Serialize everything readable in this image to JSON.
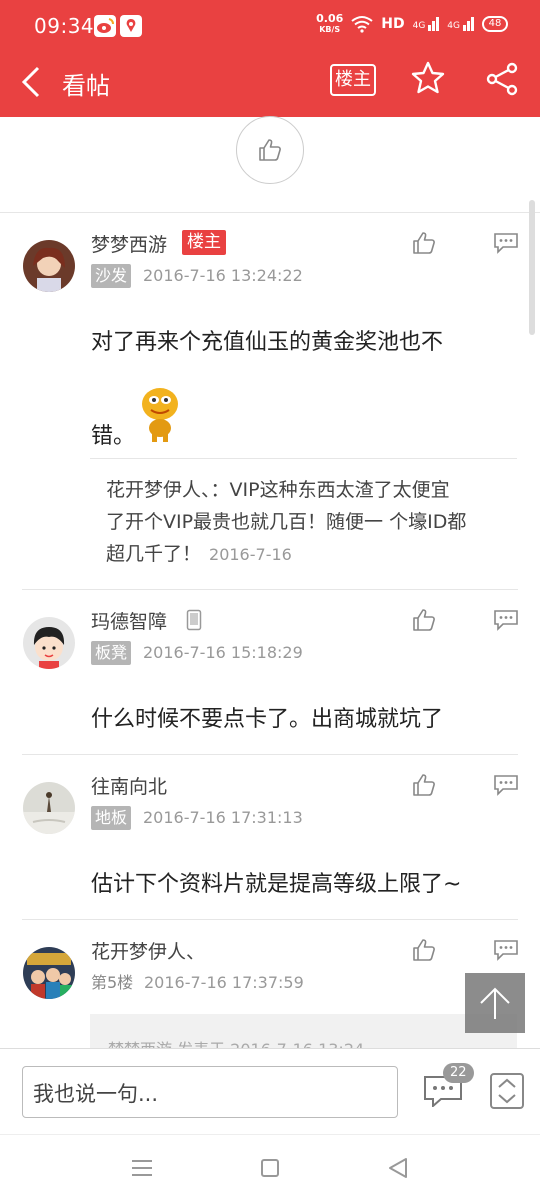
{
  "status_bar": {
    "time": "09:34",
    "net_speed_value": "0.06",
    "net_speed_unit": "KB/S",
    "hd_label": "HD",
    "signal_1": "4G",
    "signal_2": "4G",
    "battery": "48"
  },
  "header": {
    "title": "看帖",
    "louzhu_button": "楼主",
    "icons": [
      "back-icon",
      "star-icon",
      "share-icon"
    ]
  },
  "posts": [
    {
      "name": "梦梦西游",
      "tag": "楼主",
      "floor": "沙发",
      "time": "2016-7-16 13:24:22",
      "content_line1": "对了再来个充值仙玉的黄金奖池也不",
      "content_line2": "错。",
      "quote_author": "花开梦伊人、",
      "quote_text_l1": "：VIP这种东西太渣了太便宜",
      "quote_text_l2": "了开个VIP最贵也就几百！随便一 个壕ID都",
      "quote_text_l3": "超几千了！",
      "quote_time": "2016-7-16"
    },
    {
      "name": "玛德智障",
      "floor": "板凳",
      "time": "2016-7-16 15:18:29",
      "content": "什么时候不要点卡了。出商城就坑了"
    },
    {
      "name": "往南向北",
      "floor": "地板",
      "time": "2016-7-16 17:31:13",
      "content": "估计下个资料片就是提高等级上限了~"
    },
    {
      "name": "花开梦伊人、",
      "floor": "第5楼",
      "time": "2016-7-16 17:37:59",
      "quote_preview": "梦梦西游 发表于 2016-7-16 13:24"
    }
  ],
  "bottom_bar": {
    "input_placeholder": "我也说一句...",
    "comment_count": "22"
  },
  "colors": {
    "brand_red": "#e94141",
    "floor_tag_gray": "#b5b5b5"
  }
}
